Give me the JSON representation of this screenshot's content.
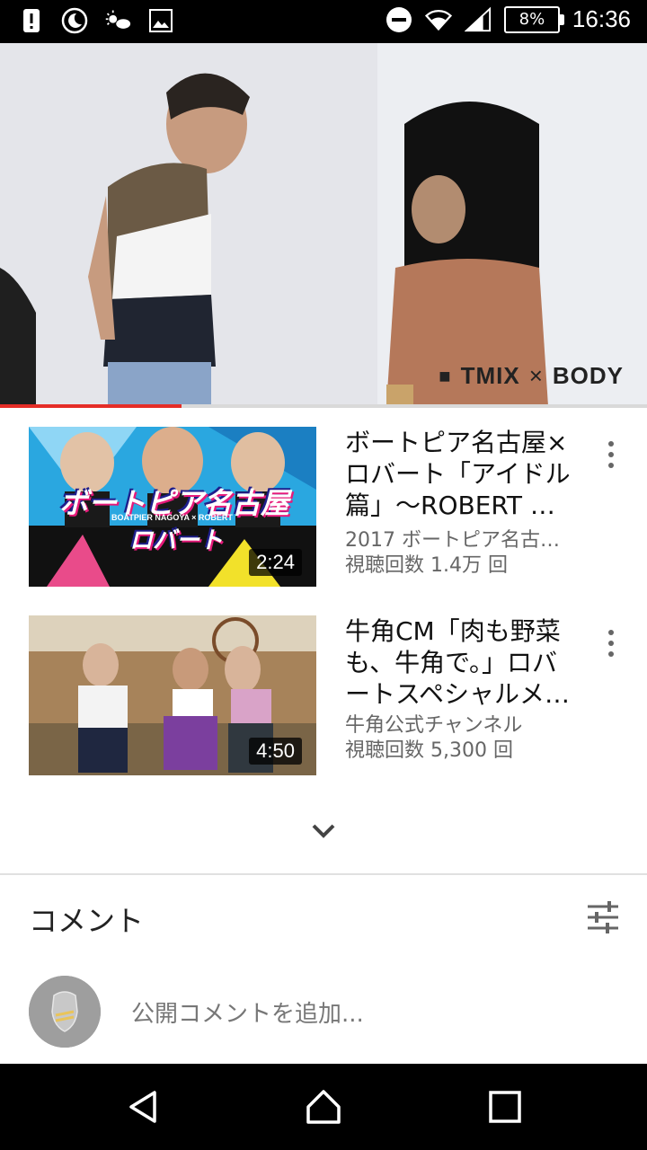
{
  "status_bar": {
    "battery": "8%",
    "time": "16:36",
    "icons": [
      "alert-icon",
      "night-mode-icon",
      "weather-icon",
      "image-icon",
      "do-not-disturb-icon",
      "wifi-icon",
      "signal-icon",
      "battery-icon"
    ]
  },
  "player": {
    "watermark_left": "TMIX",
    "watermark_x": "×",
    "watermark_right": "BODY",
    "progress": 0.28
  },
  "related": [
    {
      "title": "ボートピア名古屋×ロバート「アイドル篇」〜ROBERT …",
      "channel": "2017 ボートピア名古…",
      "views": "視聴回数 1.4万 回",
      "duration": "2:24",
      "thumb_caption_main": "ボートピア名古屋",
      "thumb_caption_sub": "BOATPIER NAGOYA × ROBERT",
      "thumb_caption_bottom": "ロバート"
    },
    {
      "title": "牛角CM「肉も野菜も、牛角で。」ロバートスペシャルメ…",
      "channel": "牛角公式チャンネル",
      "views": "視聴回数 5,300 回",
      "duration": "4:50"
    }
  ],
  "comments": {
    "header": "コメント",
    "placeholder": "公開コメントを追加..."
  },
  "colors": {
    "accent_red": "#e52d27",
    "bar_black": "#000000"
  }
}
